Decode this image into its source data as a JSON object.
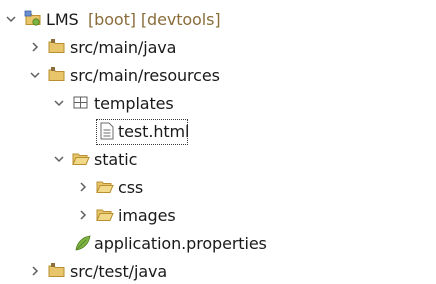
{
  "tree": {
    "project": {
      "name": "LMS",
      "decorations": "[boot] [devtools]"
    },
    "items": [
      {
        "label": "src/main/java",
        "type": "source-folder",
        "expanded": false
      },
      {
        "label": "src/main/resources",
        "type": "source-folder",
        "expanded": true
      },
      {
        "label": "templates",
        "type": "package-folder",
        "expanded": true
      },
      {
        "label": "test.html",
        "type": "file",
        "selected": true
      },
      {
        "label": "static",
        "type": "folder",
        "expanded": true
      },
      {
        "label": "css",
        "type": "folder",
        "expanded": false
      },
      {
        "label": "images",
        "type": "folder",
        "expanded": false
      },
      {
        "label": "application.properties",
        "type": "properties-file"
      },
      {
        "label": "src/test/java",
        "type": "source-folder",
        "expanded": false
      }
    ]
  },
  "colors": {
    "decoration": "#8a6d3b",
    "folder": "#e8c46a",
    "folder_outline": "#b8902e",
    "leaf": "#7cb342",
    "twistie": "#5f5f5f"
  }
}
